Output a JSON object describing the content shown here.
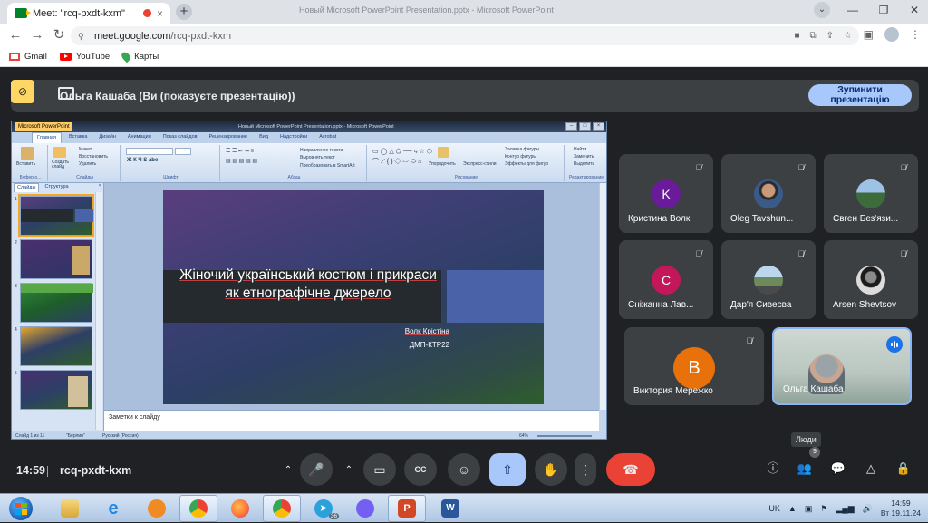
{
  "browser": {
    "tab_title": "Meet: \"rcq-pxdt-kxm\"",
    "tab_close": "×",
    "new_tab": "+",
    "window_title": "Новый Microsoft PowerPoint Presentation.pptx - Microsoft PowerPoint",
    "url_host": "meet.google.com",
    "url_path": "/rcq-pxdt-kxm",
    "bookmarks": [
      "Gmail",
      "YouTube",
      "Карты"
    ]
  },
  "meet": {
    "presenting_text": "Ольга Кашаба (Ви (показуєте презентацію))",
    "stop_line1": "Зупинити",
    "stop_line2": "презентацію",
    "time": "14:59",
    "meeting_code": "rcq-pxdt-kxm",
    "people_tooltip": "Люди",
    "people_count": "9",
    "participants": [
      {
        "name": "Кристина Волк",
        "initial": "K",
        "avatar_color": "#6a1b9a"
      },
      {
        "name": "Oleg Tavshun...",
        "initial": "",
        "avatar_color": ""
      },
      {
        "name": "Євген Без'язи...",
        "initial": "",
        "avatar_color": ""
      },
      {
        "name": "Сніжанна Лав...",
        "initial": "C",
        "avatar_color": "#c2185b"
      },
      {
        "name": "Дар'я Сивеєва",
        "initial": "",
        "avatar_color": ""
      },
      {
        "name": "Arsen Shevtsov",
        "initial": "",
        "avatar_color": ""
      },
      {
        "name": "Виктория Мережко",
        "initial": "В",
        "avatar_color": "#e8710a"
      },
      {
        "name": "Ольга Кашаба",
        "initial": "",
        "avatar_color": ""
      }
    ]
  },
  "powerpoint": {
    "app_button": "Microsoft PowerPoint",
    "ribbon_tabs": [
      "Главная",
      "Вставка",
      "Дизайн",
      "Анимация",
      "Показ слайдов",
      "Рецензирование",
      "Вид",
      "Надстройки",
      "Acrobat"
    ],
    "ribbon_groups": {
      "clipboard": "Буфер о...",
      "slides": "Слайды",
      "font": "Шрифт",
      "paragraph": "Абзац",
      "drawing": "Рисование",
      "editing": "Редактирование"
    },
    "ribbon_items": {
      "paste": "Вставить",
      "new_slide": "Создать слайд",
      "layout": "Макет",
      "reset": "Восстановить",
      "delete": "Удалить",
      "text_direction": "Направление текста",
      "align_text": "Выровнять текст",
      "smartart": "Преобразовать в SmartArt",
      "arrange": "Упорядочить",
      "quick_styles": "Экспресс-стили",
      "shape_fill": "Заливка фигуры",
      "shape_outline": "Контур фигуры",
      "shape_effects": "Эффекты для фигур",
      "find": "Найти",
      "replace": "Заменить",
      "select": "Выделить"
    },
    "pane_tabs": [
      "Слайды",
      "Структура"
    ],
    "pane_close": "×",
    "thumb_numbers": [
      "1",
      "2",
      "3",
      "4",
      "5"
    ],
    "slide": {
      "title": "Жіночий український костюм і прикраси як етнографічне джерело",
      "author": "Волк Крістіна",
      "group": "ДМП-КТР22"
    },
    "notes_placeholder": "Заметки к слайду",
    "status": {
      "slide_count": "Слайд 1 из 11",
      "theme": "\"Берлин\"",
      "language": "Русский (Россия)",
      "zoom": "64%"
    }
  },
  "taskbar": {
    "lang": "UK",
    "time": "14:59",
    "date": "Вт 19.11.24",
    "telegram_badge": "36"
  }
}
